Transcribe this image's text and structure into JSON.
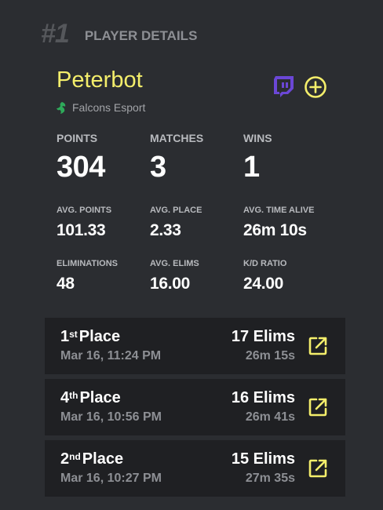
{
  "header": {
    "rank": "#1",
    "title": "PLAYER DETAILS"
  },
  "player": {
    "name": "Peterbot",
    "team": "Falcons Esport"
  },
  "stats": {
    "points": {
      "label": "POINTS",
      "value": "304"
    },
    "matches": {
      "label": "MATCHES",
      "value": "3"
    },
    "wins": {
      "label": "WINS",
      "value": "1"
    },
    "avg_points": {
      "label": "AVG. POINTS",
      "value": "101.33"
    },
    "avg_place": {
      "label": "AVG. PLACE",
      "value": "2.33"
    },
    "avg_time_alive": {
      "label": "AVG. TIME ALIVE",
      "value": "26m 10s"
    },
    "eliminations": {
      "label": "ELIMINATIONS",
      "value": "48"
    },
    "avg_elims": {
      "label": "AVG. ELIMS",
      "value": "16.00"
    },
    "kd_ratio": {
      "label": "K/D RATIO",
      "value": "24.00"
    }
  },
  "matches": [
    {
      "place_num": "1",
      "place_suffix": "st",
      "place_word": "Place",
      "date": "Mar 16, 11:24 PM",
      "elims": "17 Elims",
      "time": "26m 15s"
    },
    {
      "place_num": "4",
      "place_suffix": "th",
      "place_word": "Place",
      "date": "Mar 16, 10:56 PM",
      "elims": "16 Elims",
      "time": "26m 41s"
    },
    {
      "place_num": "2",
      "place_suffix": "nd",
      "place_word": "Place",
      "date": "Mar 16, 10:27 PM",
      "elims": "15 Elims",
      "time": "27m 35s"
    }
  ],
  "icons": {
    "twitch": "twitch-icon",
    "add": "plus-circle-icon",
    "team": "falcon-logo-icon",
    "open": "external-link-icon"
  },
  "colors": {
    "accent": "#f4ee6b",
    "twitch": "#6b47d6",
    "team": "#2eaa5a",
    "background": "#2b2d31",
    "card": "#1f2023"
  }
}
